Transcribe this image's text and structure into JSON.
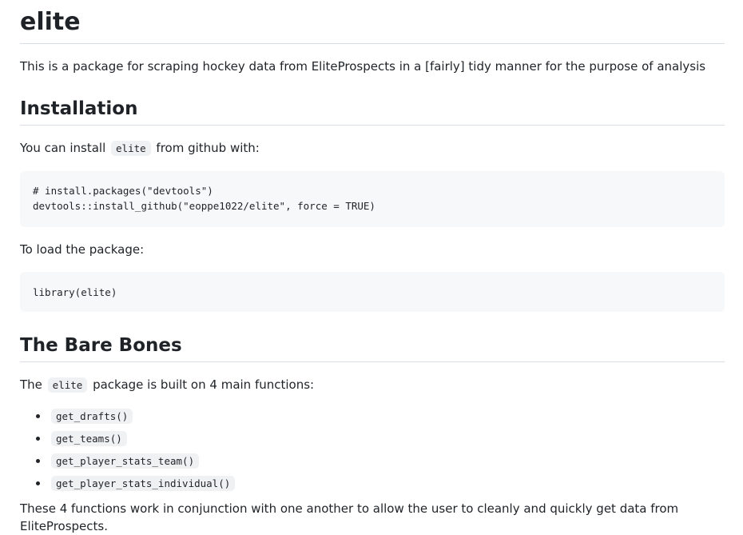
{
  "title": "elite",
  "description": "This is a package for scraping hockey data from EliteProspects in a [fairly] tidy manner for the purpose of analysis",
  "installation": {
    "heading": "Installation",
    "intro_before": "You can install ",
    "intro_code": "elite",
    "intro_after": " from github with:",
    "code_lines": [
      "# install.packages(\"devtools\")",
      "devtools::install_github(\"eoppe1022/elite\", force = TRUE)"
    ],
    "load_text": "To load the package:",
    "load_code": "library(elite)"
  },
  "bare_bones": {
    "heading": "The Bare Bones",
    "intro_before": "The ",
    "intro_code": "elite",
    "intro_after": " package is built on 4 main functions:",
    "functions": [
      "get_drafts()",
      "get_teams()",
      "get_player_stats_team()",
      "get_player_stats_individual()"
    ],
    "outro": "These 4 functions work in conjunction with one another to allow the user to cleanly and quickly get data from EliteProspects."
  }
}
